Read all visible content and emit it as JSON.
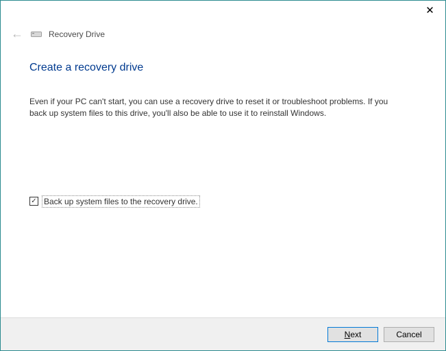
{
  "titlebar": {
    "close_symbol": "✕"
  },
  "header": {
    "back_arrow": "←",
    "app_title": "Recovery Drive"
  },
  "main": {
    "heading": "Create a recovery drive",
    "body_text": "Even if your PC can't start, you can use a recovery drive to reset it or troubleshoot problems. If you back up system files to this drive, you'll also be able to use it to reinstall Windows.",
    "checkbox": {
      "checked_symbol": "✓",
      "label": "Back up system files to the recovery drive."
    }
  },
  "footer": {
    "next_prefix": "N",
    "next_rest": "ext",
    "cancel_label": "Cancel"
  }
}
